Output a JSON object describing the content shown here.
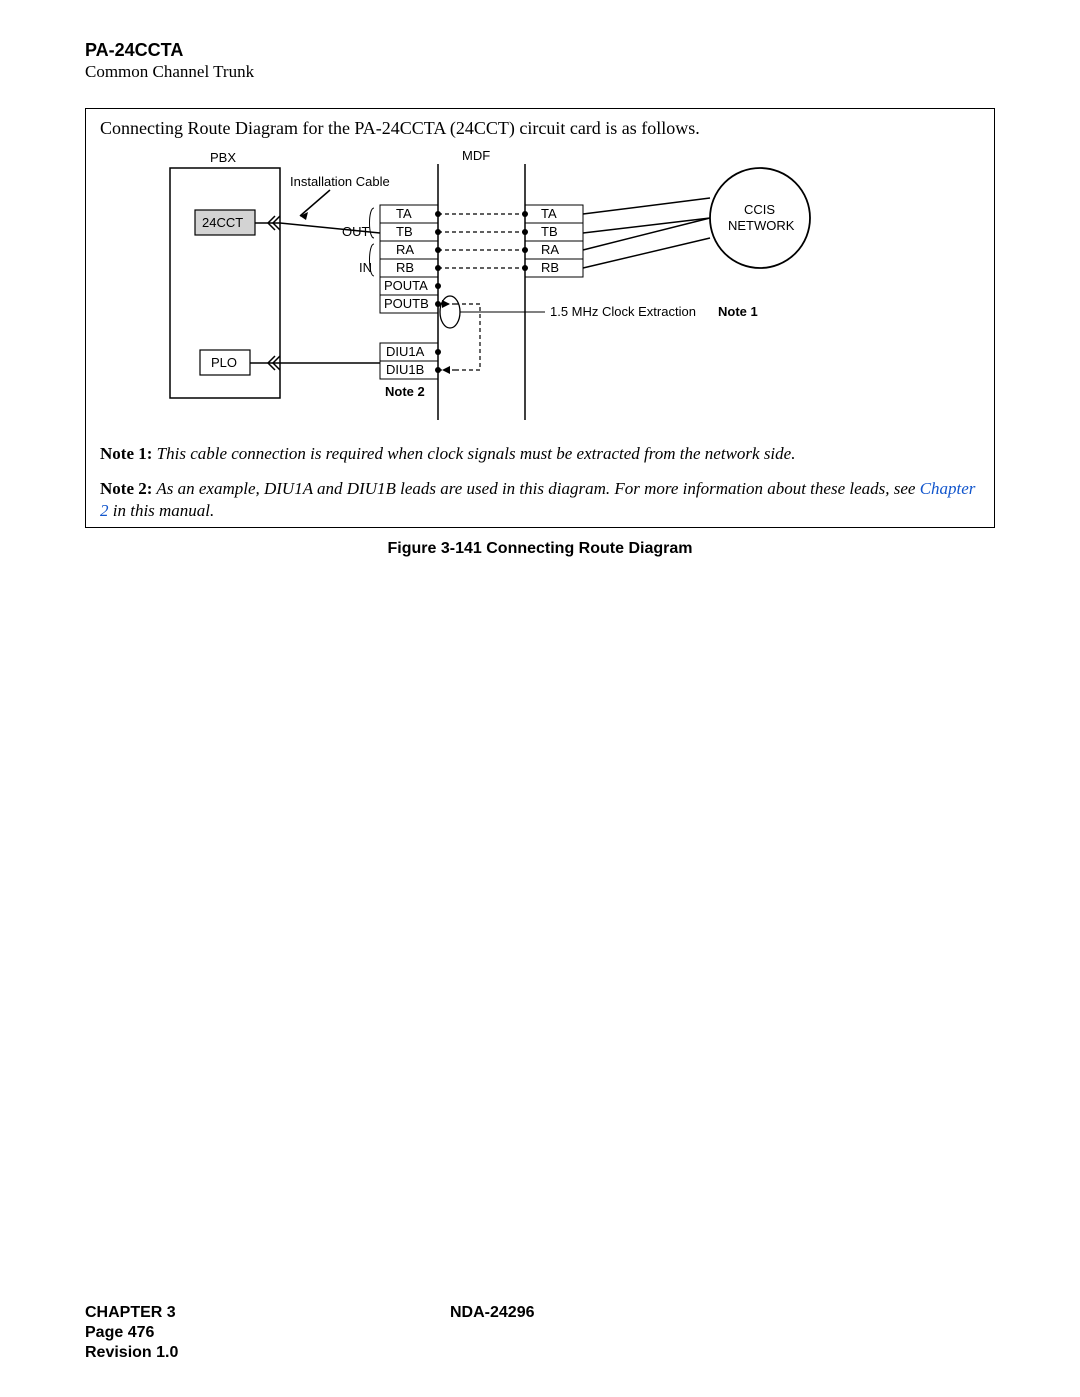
{
  "header": {
    "code": "PA-24CCTA",
    "subtitle": "Common Channel Trunk"
  },
  "figure": {
    "intro_text": "Connecting Route Diagram for the PA-24CCTA (24CCT) circuit card is as follows.",
    "caption": "Figure 3-141   Connecting Route Diagram",
    "diagram": {
      "pbx_label": "PBX",
      "mdf_label": "MDF",
      "ccis_label1": "CCIS",
      "ccis_label2": "NETWORK",
      "box_24cct": "24CCT",
      "box_plo": "PLO",
      "install_cable": "Installation Cable",
      "out_label": "OUT",
      "in_label": "IN",
      "leads_left": [
        "TA",
        "TB",
        "RA",
        "RB",
        "POUTA",
        "POUTB",
        "DIU1A",
        "DIU1B"
      ],
      "leads_right": [
        "TA",
        "TB",
        "RA",
        "RB"
      ],
      "clock_note": "1.5 MHz Clock Extraction",
      "clock_note_bold": "Note 1",
      "note2_label": "Note 2"
    },
    "notes": {
      "n1_label": "Note 1:",
      "n1_text": "This cable connection is required when clock signals must be extracted from the network side.",
      "n2_label": "Note 2:",
      "n2_text_a": "As an example, DIU1A and DIU1B leads are used in this diagram. For more information about these leads, see ",
      "n2_link": "Chapter 2",
      "n2_text_b": " in this manual."
    }
  },
  "footer": {
    "chapter": "CHAPTER 3",
    "page": "Page 476",
    "revision": "Revision 1.0",
    "doc": "NDA-24296"
  }
}
